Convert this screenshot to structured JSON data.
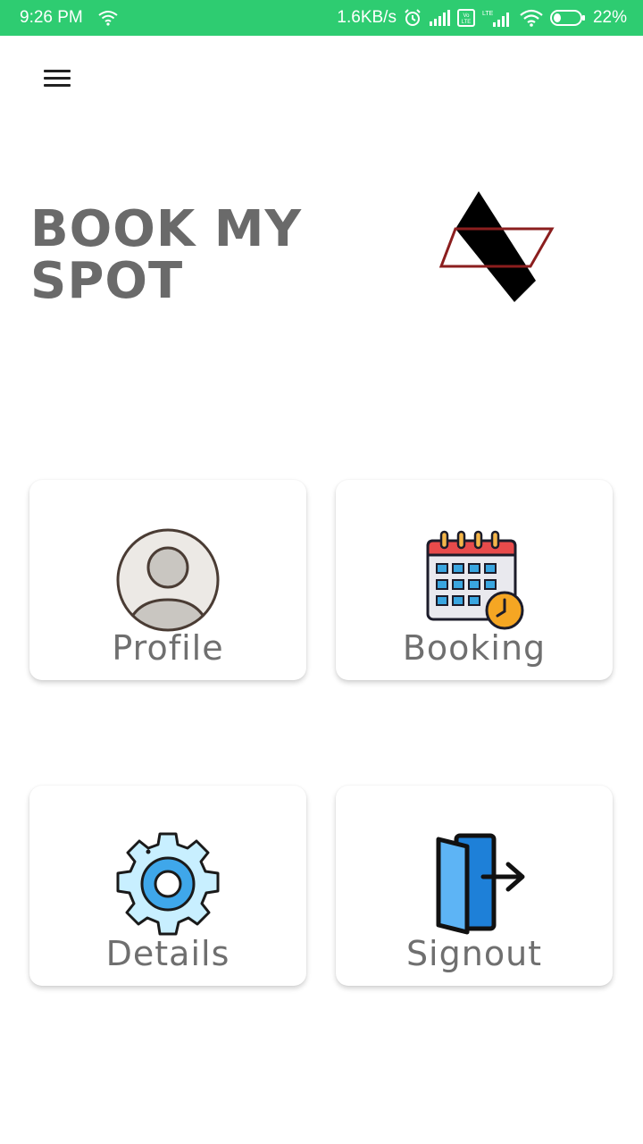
{
  "status_bar": {
    "time": "9:26 PM",
    "speed": "1.6KB/s",
    "battery": "22%",
    "icons": [
      "wifi-icon",
      "alarm-icon",
      "signal-icon",
      "volte-icon",
      "lte-signal-icon",
      "wifi-icon",
      "battery-icon"
    ]
  },
  "app": {
    "title": "BOOK MY SPOT",
    "menu_icon": "hamburger-menu-icon",
    "logo_icon": "book-my-spot-logo"
  },
  "cards": [
    {
      "label": "Profile",
      "icon": "user-avatar-icon"
    },
    {
      "label": "Booking",
      "icon": "calendar-clock-icon"
    },
    {
      "label": "Details",
      "icon": "gear-icon"
    },
    {
      "label": "Signout",
      "icon": "door-exit-icon"
    }
  ],
  "colors": {
    "status_bar": "#2ecc71",
    "title_text": "#6a6a6a",
    "card_label": "#6f6f6f",
    "logo_dark": "#000000",
    "logo_outline": "#8b1e1e"
  }
}
